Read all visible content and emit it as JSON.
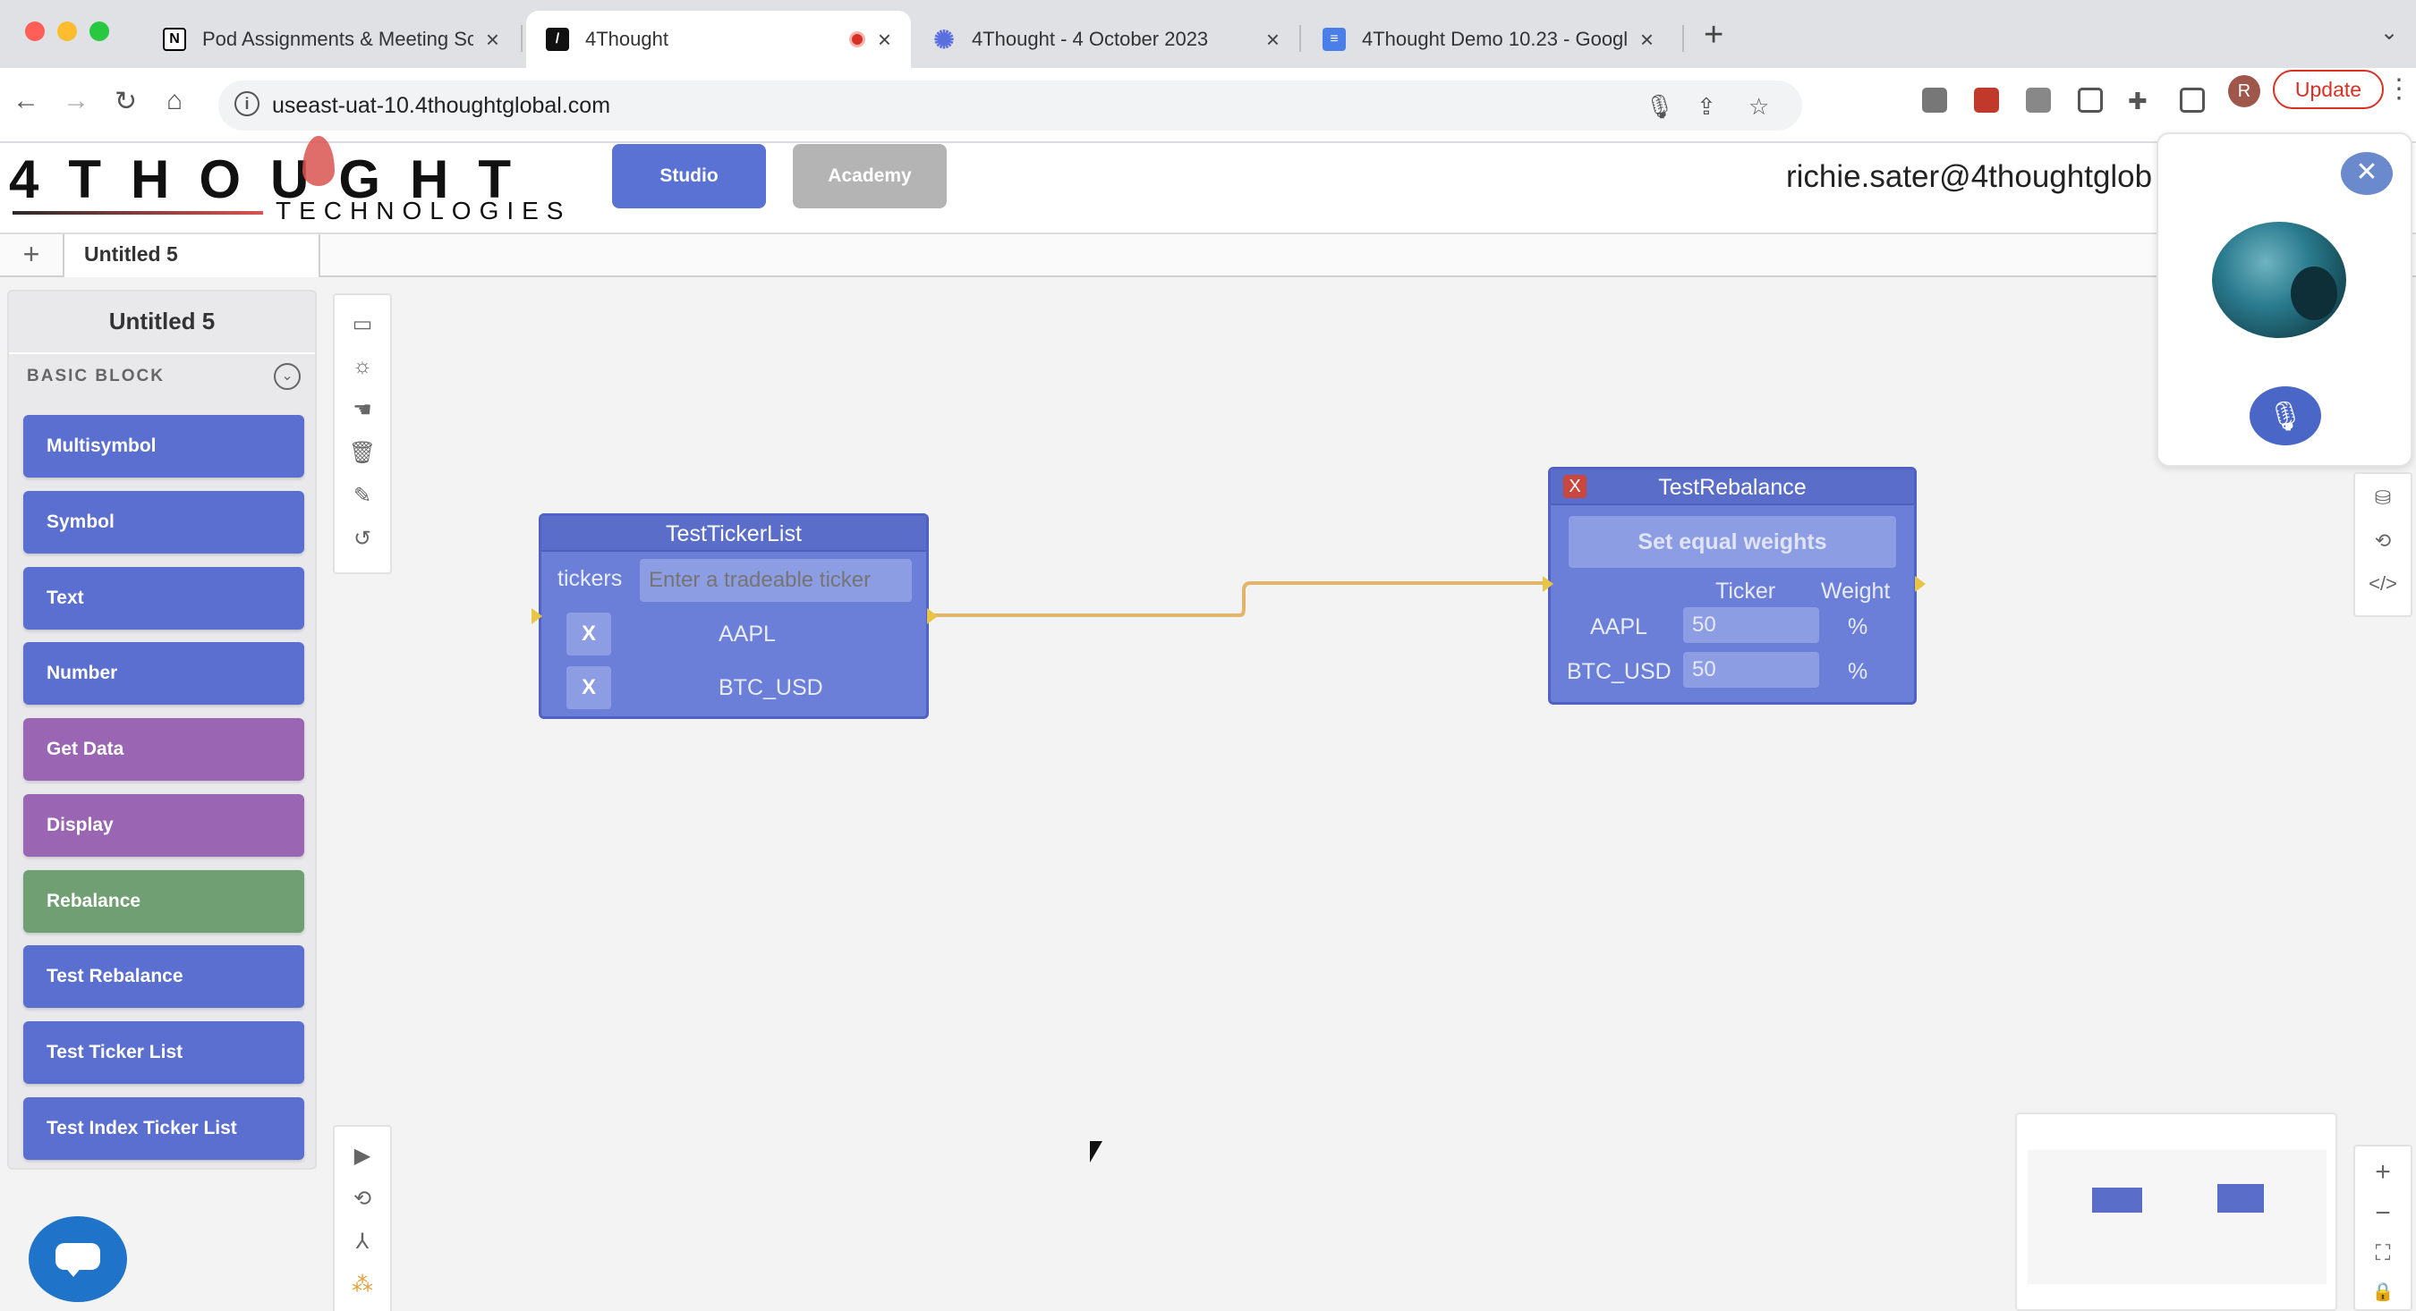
{
  "browser": {
    "tabs": [
      {
        "title": "Pod Assignments & Meeting Sc",
        "favicon": "notion-icon",
        "active": false
      },
      {
        "title": "4Thought",
        "favicon": "4thought-icon",
        "active": true,
        "recording": true
      },
      {
        "title": "4Thought - 4 October 2023",
        "favicon": "sparkle-icon",
        "active": false
      },
      {
        "title": "4Thought Demo 10.23 - Googl",
        "favicon": "google-docs-icon",
        "active": false
      }
    ],
    "url": "useast-uat-10.4thoughtglobal.com",
    "profile_initial": "R",
    "update_label": "Update",
    "colors": {
      "update": "#d93025",
      "tabbar": "#dfe1e5"
    }
  },
  "header": {
    "logo_main": "4THOUGHT",
    "logo_sub": "TECHNOLOGIES",
    "studio_label": "Studio",
    "academy_label": "Academy",
    "user_email": "richie.sater@4thoughtglob",
    "colors": {
      "studio": "#5a72d4",
      "academy": "#b4b4b4"
    }
  },
  "doc_tabs": {
    "add_label": "+",
    "active_tab": "Untitled 5"
  },
  "sidebar": {
    "title": "Untitled 5",
    "section": "BASIC BLOCK",
    "blocks": [
      {
        "label": "Multisymbol",
        "color": "#5a6fcf"
      },
      {
        "label": "Symbol",
        "color": "#5a6fcf"
      },
      {
        "label": "Text",
        "color": "#5a6fcf"
      },
      {
        "label": "Number",
        "color": "#5a6fcf"
      },
      {
        "label": "Get Data",
        "color": "#9a65b3"
      },
      {
        "label": "Display",
        "color": "#9a65b3"
      },
      {
        "label": "Rebalance",
        "color": "#6f9f72"
      },
      {
        "label": "Test Rebalance",
        "color": "#5a6fcf"
      },
      {
        "label": "Test Ticker List",
        "color": "#5a6fcf"
      },
      {
        "label": "Test Index Ticker List",
        "color": "#5a6fcf"
      }
    ]
  },
  "ticker_node": {
    "title": "TestTickerList",
    "field_label": "tickers",
    "placeholder": "Enter a tradeable ticker",
    "items": [
      "AAPL",
      "BTC_USD"
    ],
    "remove_label": "X"
  },
  "rebalance_node": {
    "title": "TestRebalance",
    "close_label": "X",
    "equal_button": "Set equal weights",
    "col_ticker": "Ticker",
    "col_weight": "Weight",
    "rows": [
      {
        "ticker": "AAPL",
        "weight": "50",
        "unit": "%"
      },
      {
        "ticker": "BTC_USD",
        "weight": "50",
        "unit": "%"
      }
    ]
  },
  "call_panel": {
    "close_label": "✕",
    "mute_icon": "microphone-off-icon"
  },
  "zoom": {
    "plus": "+",
    "minus": "−"
  }
}
